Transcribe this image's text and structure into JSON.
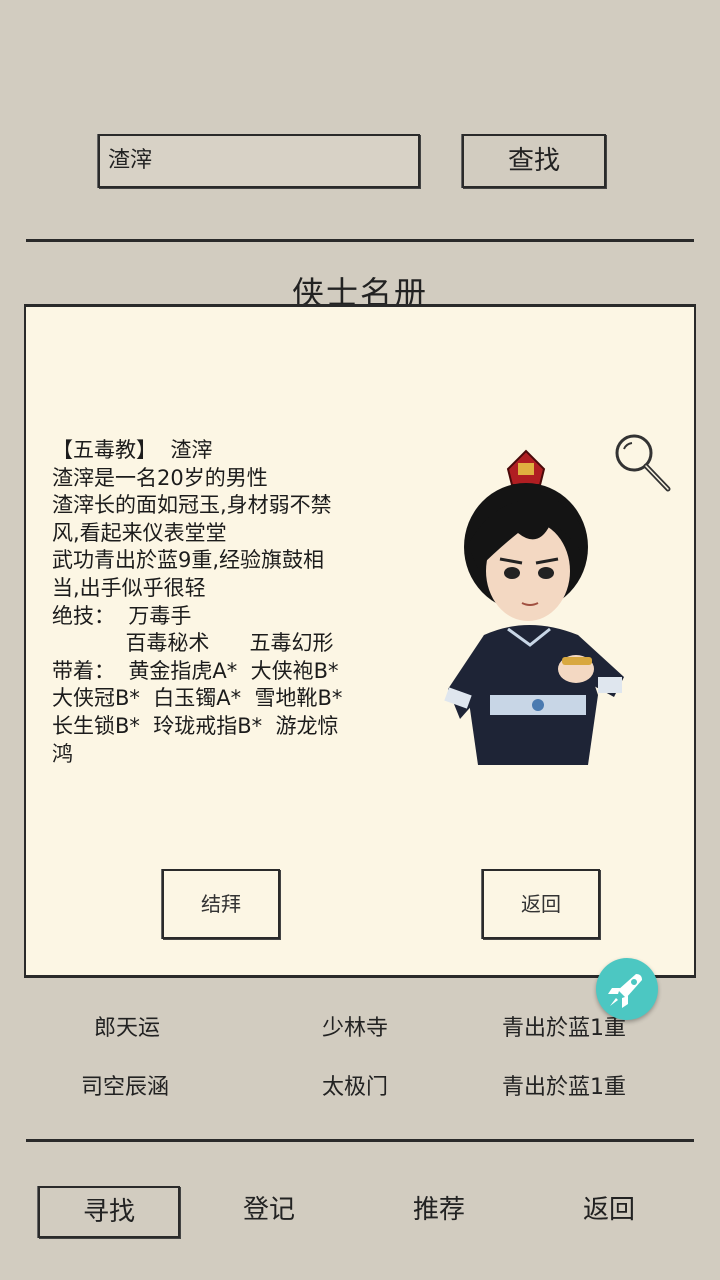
{
  "search": {
    "value": "渣滓",
    "button_label": "查找"
  },
  "section_title": "侠士名册",
  "profile": {
    "lines": [
      "【五毒教】  渣滓",
      "渣滓是一名20岁的男性",
      "渣滓长的面如冠玉,身材弱不禁",
      "风,看起来仪表堂堂",
      "武功青出於蓝9重,经验旗鼓相",
      "当,出手似乎很轻",
      "绝技：  万毒手",
      "           百毒秘术      五毒幻形",
      "带着：  黄金指虎A*  大侠袍B*",
      "大侠冠B*  白玉镯A*  雪地靴B*",
      "长生锁B*  玲珑戒指B*  游龙惊",
      "鸿"
    ],
    "bond_button": "结拜",
    "back_button": "返回"
  },
  "list": [
    {
      "name": "郎天运",
      "sect": "少林寺",
      "skill": "青出於蓝1重"
    },
    {
      "name": "司空辰涵",
      "sect": "太极门",
      "skill": "青出於蓝1重"
    }
  ],
  "bottom_tabs": [
    "寻找",
    "登记",
    "推荐",
    "返回"
  ],
  "colors": {
    "background": "#d2ccc0",
    "panel": "#fcf6e4",
    "accent": "#4cc7c2"
  },
  "icons": {
    "magnifier": "magnifier-icon",
    "rocket": "rocket-icon",
    "avatar": "character-portrait"
  }
}
